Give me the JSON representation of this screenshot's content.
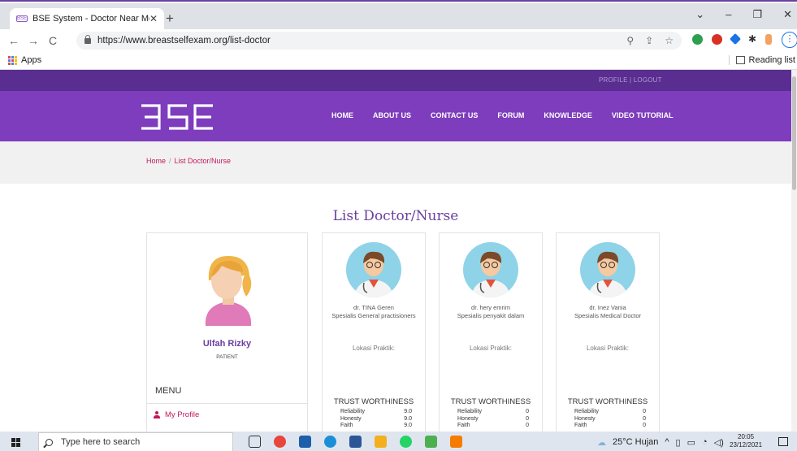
{
  "browser": {
    "tab_title": "BSE System - Doctor Near Me",
    "tab_favicon_label": "BSE",
    "url": "https://www.breastselfexam.org/list-doctor",
    "apps_label": "Apps",
    "reading_list_label": "Reading list"
  },
  "site": {
    "top_links": "PROFILE  |  LOGOUT",
    "logo_text": "BSE",
    "nav": [
      "HOME",
      "ABOUT US",
      "CONTACT US",
      "FORUM",
      "KNOWLEDGE",
      "VIDEO TUTORIAL"
    ],
    "breadcrumb": {
      "home": "Home",
      "sep": "/",
      "current": "List Doctor/Nurse"
    },
    "page_title": "List Doctor/Nurse"
  },
  "profile": {
    "name": "Ulfah Rizky",
    "role": "PATIENT",
    "menu_heading": "MENU",
    "menu_items": [
      "My Profile"
    ]
  },
  "doctors": [
    {
      "name": "dr. TINA Geren",
      "specialty": "Spesialis General practisioners",
      "location": "Lokasi Praktik:",
      "trust_heading": "TRUST WORTHINESS",
      "scores": [
        {
          "label": "Reliability",
          "value": "9.0"
        },
        {
          "label": "Honesty",
          "value": "9.0"
        },
        {
          "label": "Faith",
          "value": "9.0"
        }
      ]
    },
    {
      "name": "dr. hery emrim",
      "specialty": "Spesialis penyakit dalam",
      "location": "Lokasi Praktik:",
      "trust_heading": "TRUST WORTHINESS",
      "scores": [
        {
          "label": "Reliability",
          "value": "0"
        },
        {
          "label": "Honesty",
          "value": "0"
        },
        {
          "label": "Faith",
          "value": "0"
        }
      ]
    },
    {
      "name": "dr. Inez Vania",
      "specialty": "Spesialis Medical Doctor",
      "location": "Lokasi Praktik:",
      "trust_heading": "TRUST WORTHINESS",
      "scores": [
        {
          "label": "Reliability",
          "value": "0"
        },
        {
          "label": "Honesty",
          "value": "0"
        },
        {
          "label": "Faith",
          "value": "0"
        }
      ]
    }
  ],
  "taskbar": {
    "search_placeholder": "Type here to search",
    "weather": "25°C  Hujan",
    "time": "20:05",
    "date": "23/12/2021"
  },
  "colors": {
    "brand_dark": "#5a2d91",
    "brand": "#7e3dbd",
    "accent": "#c2185b"
  }
}
